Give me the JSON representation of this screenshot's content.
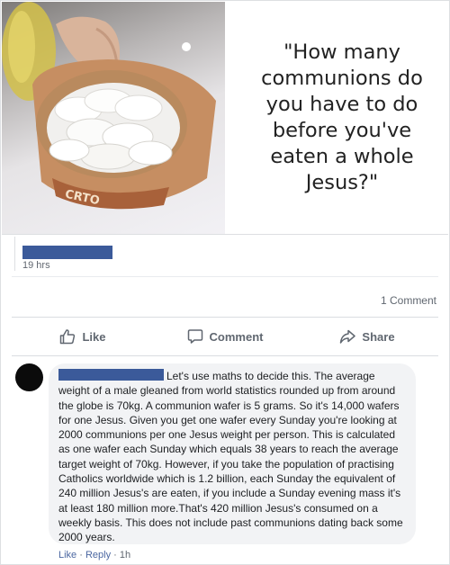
{
  "post": {
    "meme_text": "\"How many\ncommunions do\nyou have to do\nbefore you've\neaten a whole\nJesus?\"",
    "wafer_box_text": "CRTO",
    "timestamp": "19 hrs",
    "comment_count": "1 Comment"
  },
  "actions": {
    "like": "Like",
    "comment": "Comment",
    "share": "Share"
  },
  "comment": {
    "text": "Let's use maths to decide this. The average weight of a male gleaned from world statistics rounded up from around the globe is 70kg. A communion wafer is 5 grams. So it's 14,000 wafers for one Jesus. Given you get one wafer every Sunday you're looking at 2000 communions per one Jesus weight per person. This is calculated as one wafer each Sunday which equals 38 years to reach the average target weight of 70kg. However, if you take the population of practising Catholics worldwide which is 1.2 billion, each Sunday the equivalent of 240 million Jesus's are eaten, if you include a Sunday evening mass it's at least 180 million more.That's 420 million Jesus's consumed on a weekly basis. This does not include past communions dating back some 2000 years.",
    "like": "Like",
    "dot1": " · ",
    "reply": "Reply",
    "dot2": " · ",
    "age": "1h"
  },
  "colors": {
    "name_redaction": "#3b5a9a",
    "avatar": "#0b0b0b",
    "bubble": "#f2f3f5"
  }
}
